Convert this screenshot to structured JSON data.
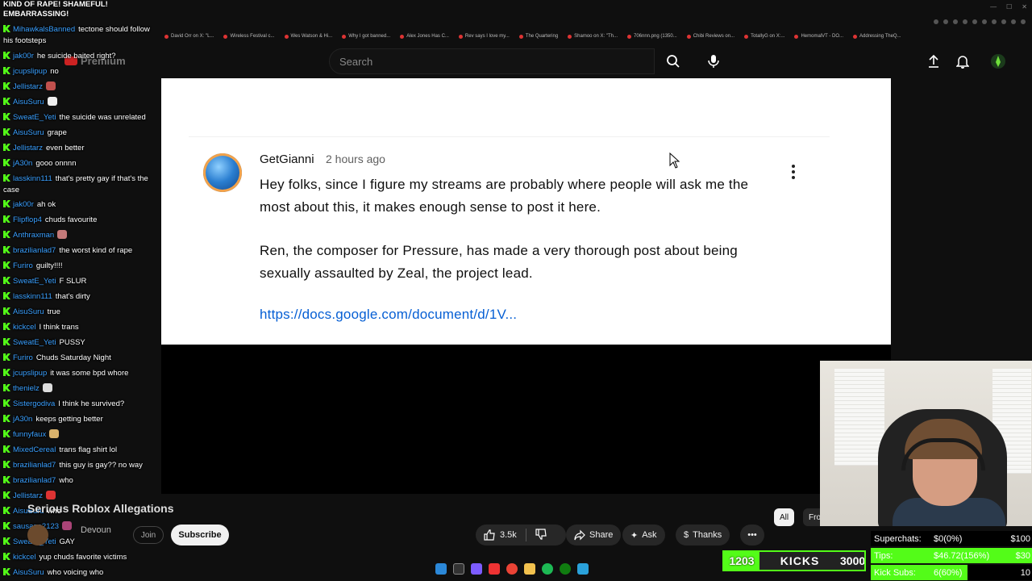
{
  "browser": {
    "bookmarks": [
      "David Orr on X: \"L...",
      "Wireless Festival c...",
      "Wes Watson & Hi...",
      "Why I got banned...",
      "Alex Jones Has C...",
      "Rev says I love my...",
      "The Quartering",
      "Shamoo on X: \"Th...",
      "706nnn.png (1350...",
      "Chibi Reviews on...",
      "TotallyG on X:...",
      "HemomalVT - DO...",
      "Addressing TheQ..."
    ]
  },
  "youtube": {
    "logo_text": "Premium",
    "search_placeholder": "Search"
  },
  "comment": {
    "author": "GetGianni",
    "time": "2 hours ago",
    "text_1": "Hey folks, since I figure my streams are probably where people will ask me the most about this, it makes enough sense to post it here.",
    "text_2": "Ren, the composer for Pressure, has made a very thorough post about being sexually assaulted by Zeal, the project lead.",
    "link": "https://docs.google.com/document/d/1V..."
  },
  "video_info": {
    "title": "Serious Roblox Allegations",
    "channel": "Devoun",
    "join_label": "Join",
    "subscribe_label": "Subscribe",
    "likes": "3.5k",
    "share_label": "Share",
    "ask_label": "Ask",
    "thanks_label": "Thanks",
    "filter_all": "All",
    "filter_from": "Fro"
  },
  "chat": {
    "banner": "KIND OF RAPE! SHAMEFUL! EMBARRASSING!",
    "messages": [
      {
        "user": "MihawkalsBanned",
        "text": "tectone should follow his footsteps"
      },
      {
        "user": "jak00r",
        "text": "he suicide baited right?"
      },
      {
        "user": "jcupslipup",
        "text": "no"
      },
      {
        "user": "Jellistarz",
        "text": ""
      },
      {
        "user": "AisuSuru",
        "text": ""
      },
      {
        "user": "SweatE_Yeti",
        "text": "the suicide was unrelated"
      },
      {
        "user": "AisuSuru",
        "text": "grape"
      },
      {
        "user": "Jellistarz",
        "text": "even better"
      },
      {
        "user": "jA30n",
        "text": "gooo onnnn"
      },
      {
        "user": "lasskinn111",
        "text": "that's pretty gay if that's the case"
      },
      {
        "user": "jak00r",
        "text": "ah ok"
      },
      {
        "user": "Flipflop4",
        "text": "chuds favourite"
      },
      {
        "user": "Anthraxman",
        "text": ""
      },
      {
        "user": "brazilianlad7",
        "text": "the worst kind of rape"
      },
      {
        "user": "Furiro",
        "text": "guilty!!!!"
      },
      {
        "user": "SweatE_Yeti",
        "text": "F SLUR"
      },
      {
        "user": "lasskinn111",
        "text": "that's dirty"
      },
      {
        "user": "AisuSuru",
        "text": "true"
      },
      {
        "user": "kickcel",
        "text": "I think trans"
      },
      {
        "user": "SweatE_Yeti",
        "text": "PUSSY"
      },
      {
        "user": "Furiro",
        "text": "Chuds Saturday Night"
      },
      {
        "user": "jcupslipup",
        "text": "it was some bpd whore"
      },
      {
        "user": "thenielz",
        "text": ""
      },
      {
        "user": "Sistergodiva",
        "text": "I think he survived?"
      },
      {
        "user": "jA30n",
        "text": "keeps getting better"
      },
      {
        "user": "funnyfaux",
        "text": ""
      },
      {
        "user": "MixedCereal",
        "text": "trans flag shirt lol"
      },
      {
        "user": "brazilianlad7",
        "text": "this guy is gay?? no way"
      },
      {
        "user": "brazilianlad7",
        "text": "who"
      },
      {
        "user": "Jellistarz",
        "text": ""
      },
      {
        "user": "AisuSuru",
        "text": "who"
      },
      {
        "user": "sausage2123",
        "text": ""
      },
      {
        "user": "SweatE_Yeti",
        "text": "GAY"
      },
      {
        "user": "kickcel",
        "text": "yup chuds favorite victims"
      },
      {
        "user": "AisuSuru",
        "text": "who voicing who"
      }
    ]
  },
  "stream_stats": {
    "superchats_label": "Superchats:",
    "superchats_value": "$0(0%)",
    "superchats_goal": "$100",
    "tips_label": "Tips:",
    "tips_value": "$46.72(156%)",
    "tips_goal": "$30",
    "tips_progress": 1.0,
    "kicksubs_label": "Kick Subs:",
    "kicksubs_value": "6(60%)",
    "kicksubs_goal": "10",
    "kicksubs_progress": 0.6,
    "kicks_current": "1203",
    "kicks_label": "KICKS",
    "kicks_goal": "3000"
  },
  "colors": {
    "kick_green": "#53fc18",
    "link_blue": "#065fd4",
    "username_blue": "#3aa0ff"
  }
}
